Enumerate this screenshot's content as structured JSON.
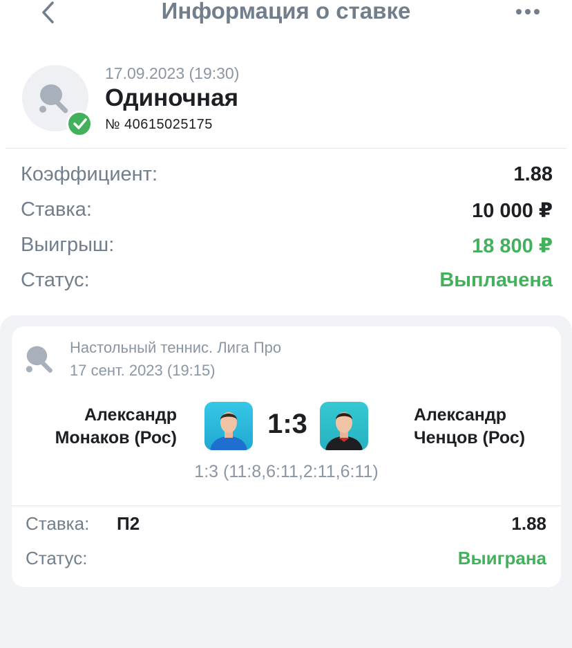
{
  "header": {
    "title": "Информация о ставке",
    "back_icon": "chevron-left-icon",
    "more_icon": "more-dots-icon"
  },
  "bet": {
    "date": "17.09.2023 (19:30)",
    "type": "Одиночная",
    "number": "№ 40615025175",
    "sport_icon": "table-tennis-icon",
    "status_icon": "check-icon"
  },
  "summary": {
    "coefficient_label": "Коэффициент:",
    "coefficient_value": "1.88",
    "stake_label": "Ставка:",
    "stake_value": "10 000 ₽",
    "payout_label": "Выигрыш:",
    "payout_value": "18 800 ₽",
    "status_label": "Статус:",
    "status_value": "Выплачена"
  },
  "event": {
    "league": "Настольный теннис. Лига Про",
    "date": "17 сент. 2023 (19:15)",
    "team1": {
      "line1": "Александр",
      "line2": "Монаков (Рос)"
    },
    "team2": {
      "line1": "Александр",
      "line2": "Ченцов (Рос)"
    },
    "score": "1:3",
    "set_scores": "1:3 (11:8,6:11,2:11,6:11)",
    "stake_label": "Ставка:",
    "pick": "П2",
    "odds": "1.88",
    "status_label": "Статус:",
    "status_value": "Выиграна"
  },
  "colors": {
    "accent_green": "#43b05c",
    "muted_text": "#717f8c",
    "light_text": "#8a96a3",
    "dark_text": "#1c1f23"
  }
}
